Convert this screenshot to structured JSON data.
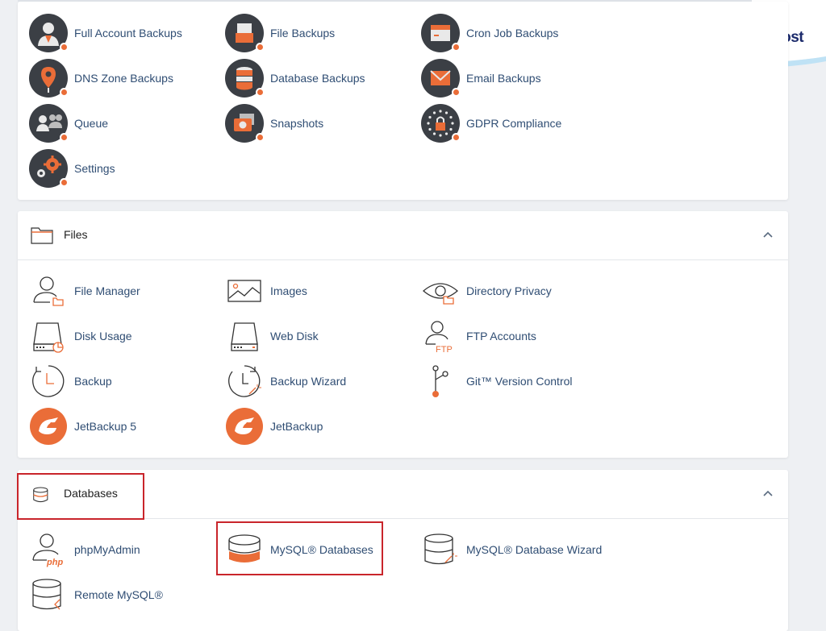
{
  "brand": {
    "name": "Maral Host"
  },
  "backups": {
    "items": [
      {
        "label": "Full Account Backups",
        "icon": "user-backup-icon"
      },
      {
        "label": "File Backups",
        "icon": "file-backup-icon"
      },
      {
        "label": "Cron Job Backups",
        "icon": "cron-backup-icon"
      },
      {
        "label": "DNS Zone Backups",
        "icon": "dns-backup-icon"
      },
      {
        "label": "Database Backups",
        "icon": "database-backup-icon"
      },
      {
        "label": "Email Backups",
        "icon": "email-backup-icon"
      },
      {
        "label": "Queue",
        "icon": "queue-icon"
      },
      {
        "label": "Snapshots",
        "icon": "camera-icon"
      },
      {
        "label": "GDPR Compliance",
        "icon": "gdpr-lock-icon"
      },
      {
        "label": "Settings",
        "icon": "gears-icon"
      }
    ]
  },
  "files": {
    "title": "Files",
    "items": [
      {
        "label": "File Manager",
        "icon": "user-folder-icon"
      },
      {
        "label": "Images",
        "icon": "image-icon"
      },
      {
        "label": "Directory Privacy",
        "icon": "eye-folder-icon"
      },
      {
        "label": "Disk Usage",
        "icon": "disk-usage-icon"
      },
      {
        "label": "Web Disk",
        "icon": "web-disk-icon"
      },
      {
        "label": "FTP Accounts",
        "icon": "ftp-user-icon"
      },
      {
        "label": "Backup",
        "icon": "clock-backup-icon"
      },
      {
        "label": "Backup Wizard",
        "icon": "clock-wand-icon"
      },
      {
        "label": "Git™ Version Control",
        "icon": "git-branch-icon"
      },
      {
        "label": "JetBackup 5",
        "icon": "jetbackup-logo-icon"
      },
      {
        "label": "JetBackup",
        "icon": "jetbackup-logo-icon"
      }
    ]
  },
  "databases": {
    "title": "Databases",
    "items": [
      {
        "label": "phpMyAdmin",
        "icon": "php-user-icon"
      },
      {
        "label": "MySQL® Databases",
        "icon": "mysql-database-icon"
      },
      {
        "label": "MySQL® Database Wizard",
        "icon": "database-wand-icon"
      },
      {
        "label": "Remote MySQL®",
        "icon": "remote-database-icon"
      }
    ]
  },
  "colors": {
    "accent": "#ea6d38",
    "highlight": "#c9252b",
    "text": "#2f4d73",
    "darkicon": "#3b3f45"
  }
}
